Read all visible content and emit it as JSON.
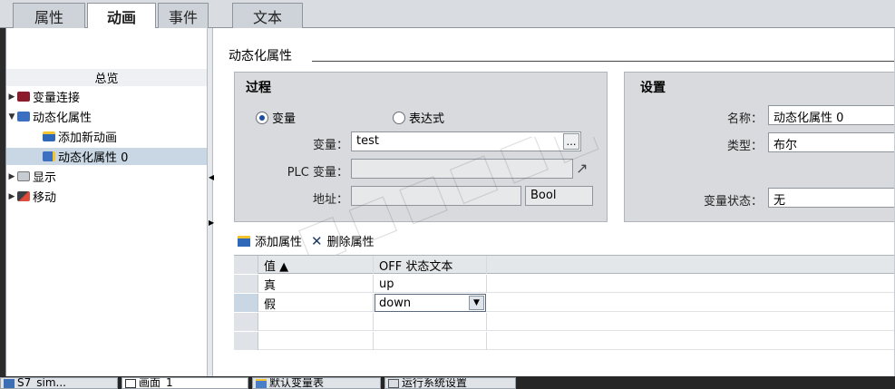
{
  "tabs": [
    {
      "label": "属性"
    },
    {
      "label": "动画"
    },
    {
      "label": "事件"
    },
    {
      "label": "文本"
    }
  ],
  "tree": {
    "overview": "总览",
    "items": [
      {
        "label": "变量连接",
        "arrow": "▶",
        "icon": "tag-link-icon"
      },
      {
        "label": "动态化属性",
        "arrow": "▼",
        "icon": "dynamic-property-icon"
      },
      {
        "label": "添加新动画",
        "icon": "add-animation-icon"
      },
      {
        "label": "动态化属性 0",
        "icon": "dynamic-property-icon"
      },
      {
        "label": "显示",
        "arrow": "▶",
        "icon": "visibility-icon"
      },
      {
        "label": "移动",
        "arrow": "▶",
        "icon": "move-icon"
      }
    ]
  },
  "content": {
    "section_title": "动态化属性",
    "process": {
      "title": "过程",
      "radio_variable": "变量",
      "radio_expression": "表达式",
      "variable_label": "变量：",
      "variable_value": "test",
      "plc_label": "PLC 变量：",
      "plc_value": "",
      "address_label": "地址：",
      "address_value": "",
      "type_value": "Bool",
      "browse_button": "…"
    },
    "settings": {
      "title": "设置",
      "name_label": "名称：",
      "name_value": "动态化属性 0",
      "type_label": "类型：",
      "type_value": "布尔",
      "state_label": "变量状态：",
      "state_value": "无"
    },
    "toolbar": {
      "add_label": "添加属性",
      "delete_label": "删除属性"
    },
    "grid": {
      "headers": [
        "值 ▲",
        "OFF 状态文本"
      ],
      "rows": [
        {
          "value": "真",
          "text": "up"
        },
        {
          "value": "假",
          "text": "down"
        }
      ]
    }
  },
  "taskbar": [
    {
      "label": "S7_sim..."
    },
    {
      "label": "画面_1"
    },
    {
      "label": "默认变量表"
    },
    {
      "label": "运行系统设置"
    }
  ],
  "colors": {
    "selection": "#c9d6e3",
    "group_bg": "#d8dadd",
    "accent": "#1a4fa0"
  }
}
